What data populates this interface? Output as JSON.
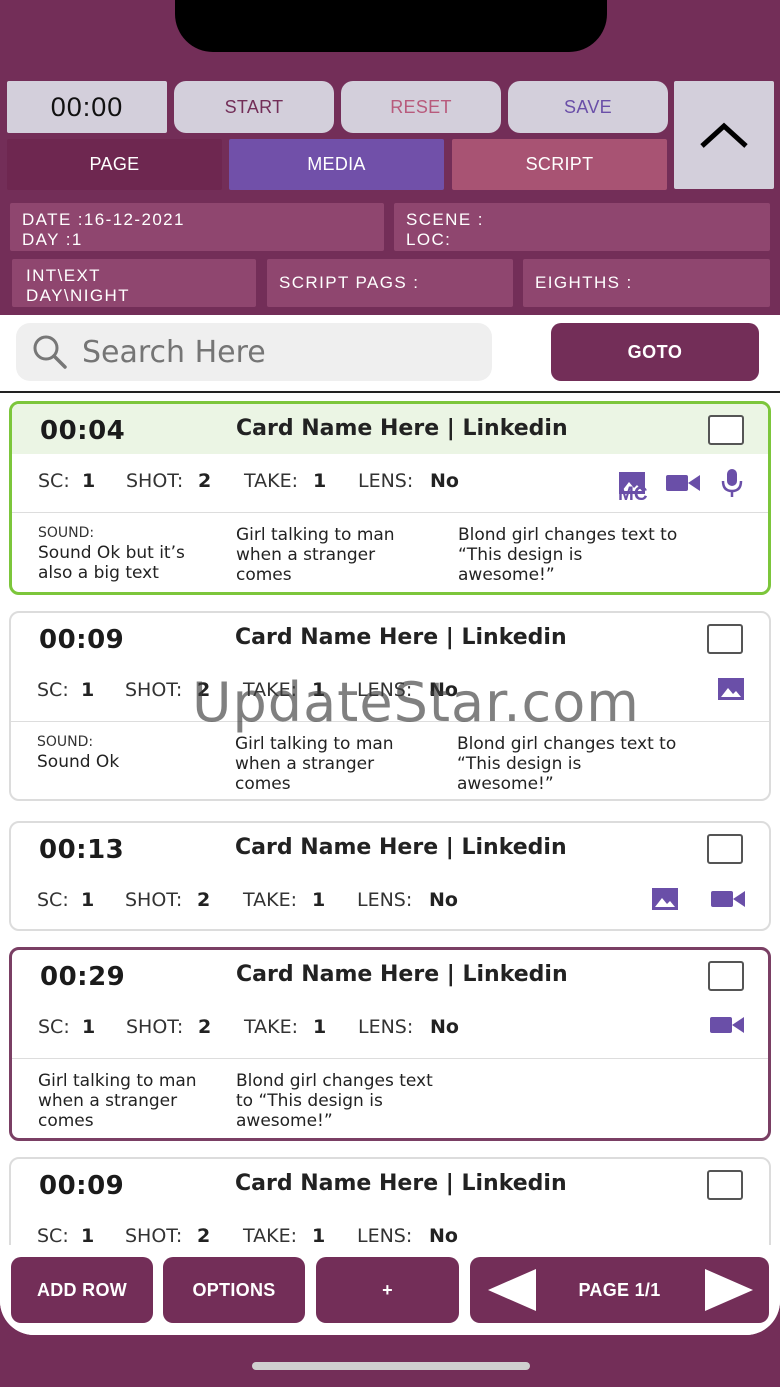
{
  "timer": "00:00",
  "buttons": {
    "start": "START",
    "reset": "RESET",
    "save": "SAVE",
    "goto": "GOTO",
    "add_row": "ADD ROW",
    "options": "OPTIONS",
    "plus": "+",
    "page": "PAGE 1/1"
  },
  "tabs": {
    "page": "PAGE",
    "media": "MEDIA",
    "script": "SCRIPT"
  },
  "info": {
    "date": "DATE :16-12-2021",
    "day": "DAY :1",
    "scene": "SCENE :",
    "loc": "LOC:",
    "int_ext": "INT\\EXT",
    "day_night": "DAY\\NIGHT",
    "script_pages": "SCRIPT PAGS :",
    "eighths": "EIGHTHS :"
  },
  "search": {
    "placeholder": "Search Here"
  },
  "labels": {
    "sc": "SC:",
    "shot": "SHOT:",
    "take": "TAKE:",
    "lens": "LENS:",
    "sound": "SOUND:",
    "mc": "MC"
  },
  "cards": [
    {
      "time": "00:04",
      "name": "Card Name Here  |  Linkedin",
      "sc": "1",
      "shot": "2",
      "take": "1",
      "lens": "No",
      "sound": "Sound Ok but it’s also a big text",
      "col2": "Girl talking to man when a stranger comes",
      "col3": "Blond girl changes text to “This design is awesome!”"
    },
    {
      "time": "00:09",
      "name": "Card Name Here  |  Linkedin",
      "sc": "1",
      "shot": "2",
      "take": "1",
      "lens": "No",
      "sound": "Sound Ok",
      "col2": "Girl talking to man when a stranger comes",
      "col3": "Blond girl changes text to “This design is awesome!”"
    },
    {
      "time": "00:13",
      "name": "Card Name Here  |  Linkedin",
      "sc": "1",
      "shot": "2",
      "take": "1",
      "lens": "No"
    },
    {
      "time": "00:29",
      "name": "Card Name Here  |  Linkedin",
      "sc": "1",
      "shot": "2",
      "take": "1",
      "lens": "No",
      "col1": "Girl talking to man when a stranger comes",
      "col2": "Blond girl changes text to “This design is awesome!”"
    },
    {
      "time": "00:09",
      "name": "Card Name Here  |  Linkedin",
      "sc": "1",
      "shot": "2",
      "take": "1",
      "lens": "No"
    }
  ],
  "watermark": "UpdateStar.com",
  "colors": {
    "brand": "#732e58",
    "media": "#7150a9",
    "script": "#a85373",
    "selected_border": "#7cc63b",
    "icon": "#6a4fa8"
  }
}
